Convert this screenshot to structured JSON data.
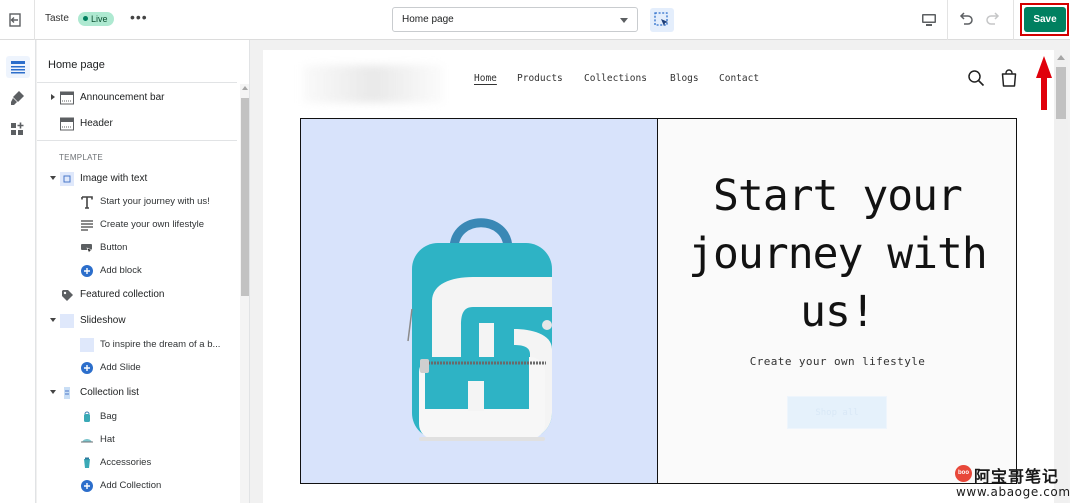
{
  "topbar": {
    "theme_name": "Taste",
    "status_badge": "Live",
    "more_label": "•••",
    "page_select": {
      "selected": "Home page"
    },
    "save_label": "Save"
  },
  "sidebar": {
    "title": "Home page",
    "sections": {
      "announcement_bar": "Announcement bar",
      "header": "Header",
      "template_heading": "TEMPLATE"
    },
    "image_with_text": {
      "label": "Image with text",
      "blocks": [
        "Start your journey with us!",
        "Create your own lifestyle",
        "Button"
      ],
      "add_block": "Add block"
    },
    "featured_collection": "Featured collection",
    "slideshow": {
      "label": "Slideshow",
      "slides": [
        "To inspire the dream of a b..."
      ],
      "add_slide": "Add Slide"
    },
    "collection_list": {
      "label": "Collection list",
      "items": [
        "Bag",
        "Hat",
        "Accessories"
      ],
      "add_collection": "Add Collection"
    }
  },
  "preview": {
    "nav": [
      "Home",
      "Products",
      "Collections",
      "Blogs",
      "Contact"
    ],
    "hero": {
      "heading": "Start your journey with us!",
      "subheading": "Create your own lifestyle",
      "button": "Shop all"
    }
  },
  "watermark": {
    "badge": "boo",
    "chinese": "阿宝哥笔记",
    "url": "www.abaoge.com"
  },
  "colors": {
    "save_green": "#008060",
    "highlight_red": "#d20000",
    "hero_image_bg": "#d8e3fb",
    "link_blue": "#2c6ecb"
  },
  "icons": [
    "exit-icon",
    "inspector-icon",
    "desktop-icon",
    "undo-icon",
    "redo-icon",
    "sections-icon",
    "theme-settings-icon",
    "apps-icon",
    "search-icon",
    "cart-icon"
  ]
}
